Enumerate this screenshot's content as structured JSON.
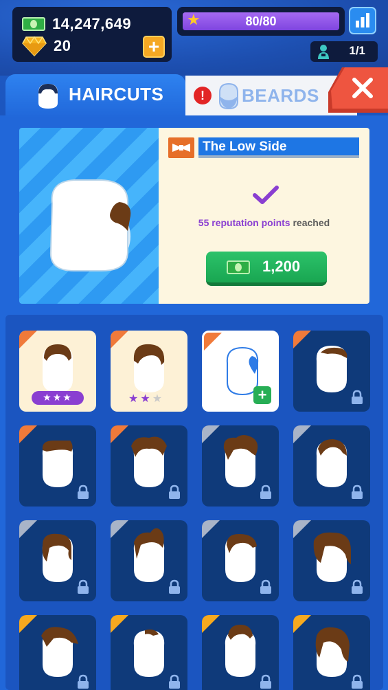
{
  "currency": {
    "cash": "14,247,649",
    "gems": "20"
  },
  "xp": {
    "label": "80/80",
    "progress": 1.0
  },
  "staff": {
    "label": "1/1"
  },
  "tabs": {
    "haircuts": "HAIRCUTS",
    "beards": "BEARDS",
    "beards_alert": "!"
  },
  "detail": {
    "name": "The Low Side",
    "reputation_value": "55 reputation points",
    "reputation_suffix": "reached",
    "price": "1,200"
  },
  "colors": {
    "accent_purple": "#8a3fd1",
    "cash_green": "#2fae45",
    "gold": "#f5a823",
    "close_red": "#e8503a"
  },
  "grid": {
    "items": [
      {
        "state": "owned",
        "tier": "orange",
        "stars": 3
      },
      {
        "state": "owned",
        "tier": "orange",
        "stars": 2
      },
      {
        "state": "selected",
        "tier": "orange"
      },
      {
        "state": "locked",
        "tier": "orange"
      },
      {
        "state": "locked",
        "tier": "orange"
      },
      {
        "state": "locked",
        "tier": "orange"
      },
      {
        "state": "locked",
        "tier": "silver"
      },
      {
        "state": "locked",
        "tier": "silver"
      },
      {
        "state": "locked",
        "tier": "silver"
      },
      {
        "state": "locked",
        "tier": "silver"
      },
      {
        "state": "locked",
        "tier": "silver"
      },
      {
        "state": "locked",
        "tier": "silver"
      },
      {
        "state": "locked",
        "tier": "gold"
      },
      {
        "state": "locked",
        "tier": "gold"
      },
      {
        "state": "locked",
        "tier": "gold"
      },
      {
        "state": "locked",
        "tier": "gold"
      }
    ]
  }
}
